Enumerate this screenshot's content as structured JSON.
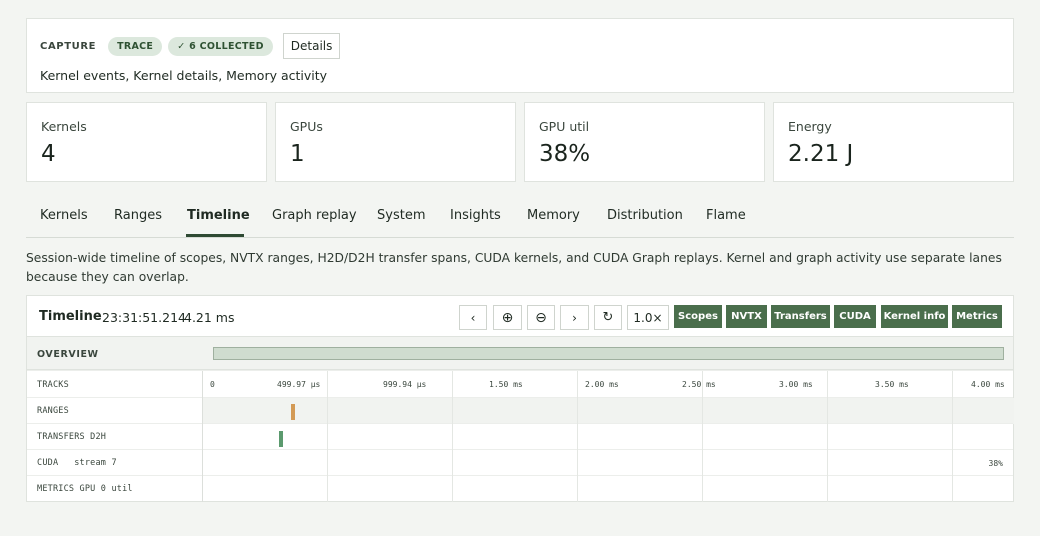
{
  "capture": {
    "label": "CAPTURE",
    "mode_pill": "TRACE",
    "collected_pill": "✓ 6 COLLECTED",
    "details_label": "Details",
    "description": "Kernel events, Kernel details, Memory activity"
  },
  "stats": [
    {
      "label": "Kernels",
      "value": "4"
    },
    {
      "label": "GPUs",
      "value": "1"
    },
    {
      "label": "GPU util",
      "value": "38%"
    },
    {
      "label": "Energy",
      "value": "2.21 J"
    }
  ],
  "tabs": [
    "Kernels",
    "Ranges",
    "Timeline",
    "Graph replay",
    "System",
    "Insights",
    "Memory",
    "Distribution",
    "Flame"
  ],
  "active_tab": "Timeline",
  "intro": "Session-wide timeline of scopes, NVTX ranges, H2D/D2H transfer spans, CUDA kernels, and CUDA Graph replays. Kernel and graph activity use separate lanes because they can overlap.",
  "timeline": {
    "title": "Timeline",
    "timestamp": "23:31:51.214",
    "duration": "4.21 ms",
    "controls": {
      "prev_icon": "‹",
      "zoom_in_icon": "⊕",
      "zoom_out_icon": "⊖",
      "next_icon": "›",
      "reset_icon": "↻",
      "zoom_level": "1.0×"
    },
    "filters": [
      "Scopes",
      "NVTX",
      "Transfers",
      "CUDA",
      "Kernel info",
      "Metrics"
    ],
    "overview_label": "OVERVIEW",
    "tracks_label": "TRACKS",
    "ticks": [
      "0",
      "499.97 µs",
      "999.94 µs",
      "1.50 ms",
      "2.00 ms",
      "2.50 ms",
      "3.00 ms",
      "3.50 ms",
      "4.00 ms"
    ],
    "rows": [
      {
        "label": "RANGES"
      },
      {
        "label": "TRANSFERS D2H"
      },
      {
        "label": "CUDA   stream 7"
      },
      {
        "label": "METRICS GPU 0 util"
      }
    ],
    "cuda_util": "38%",
    "colors": {
      "range_mark": "#d39a55",
      "transfer_mark": "#5b9a6e",
      "filter_button": "#4a6e4c"
    }
  }
}
